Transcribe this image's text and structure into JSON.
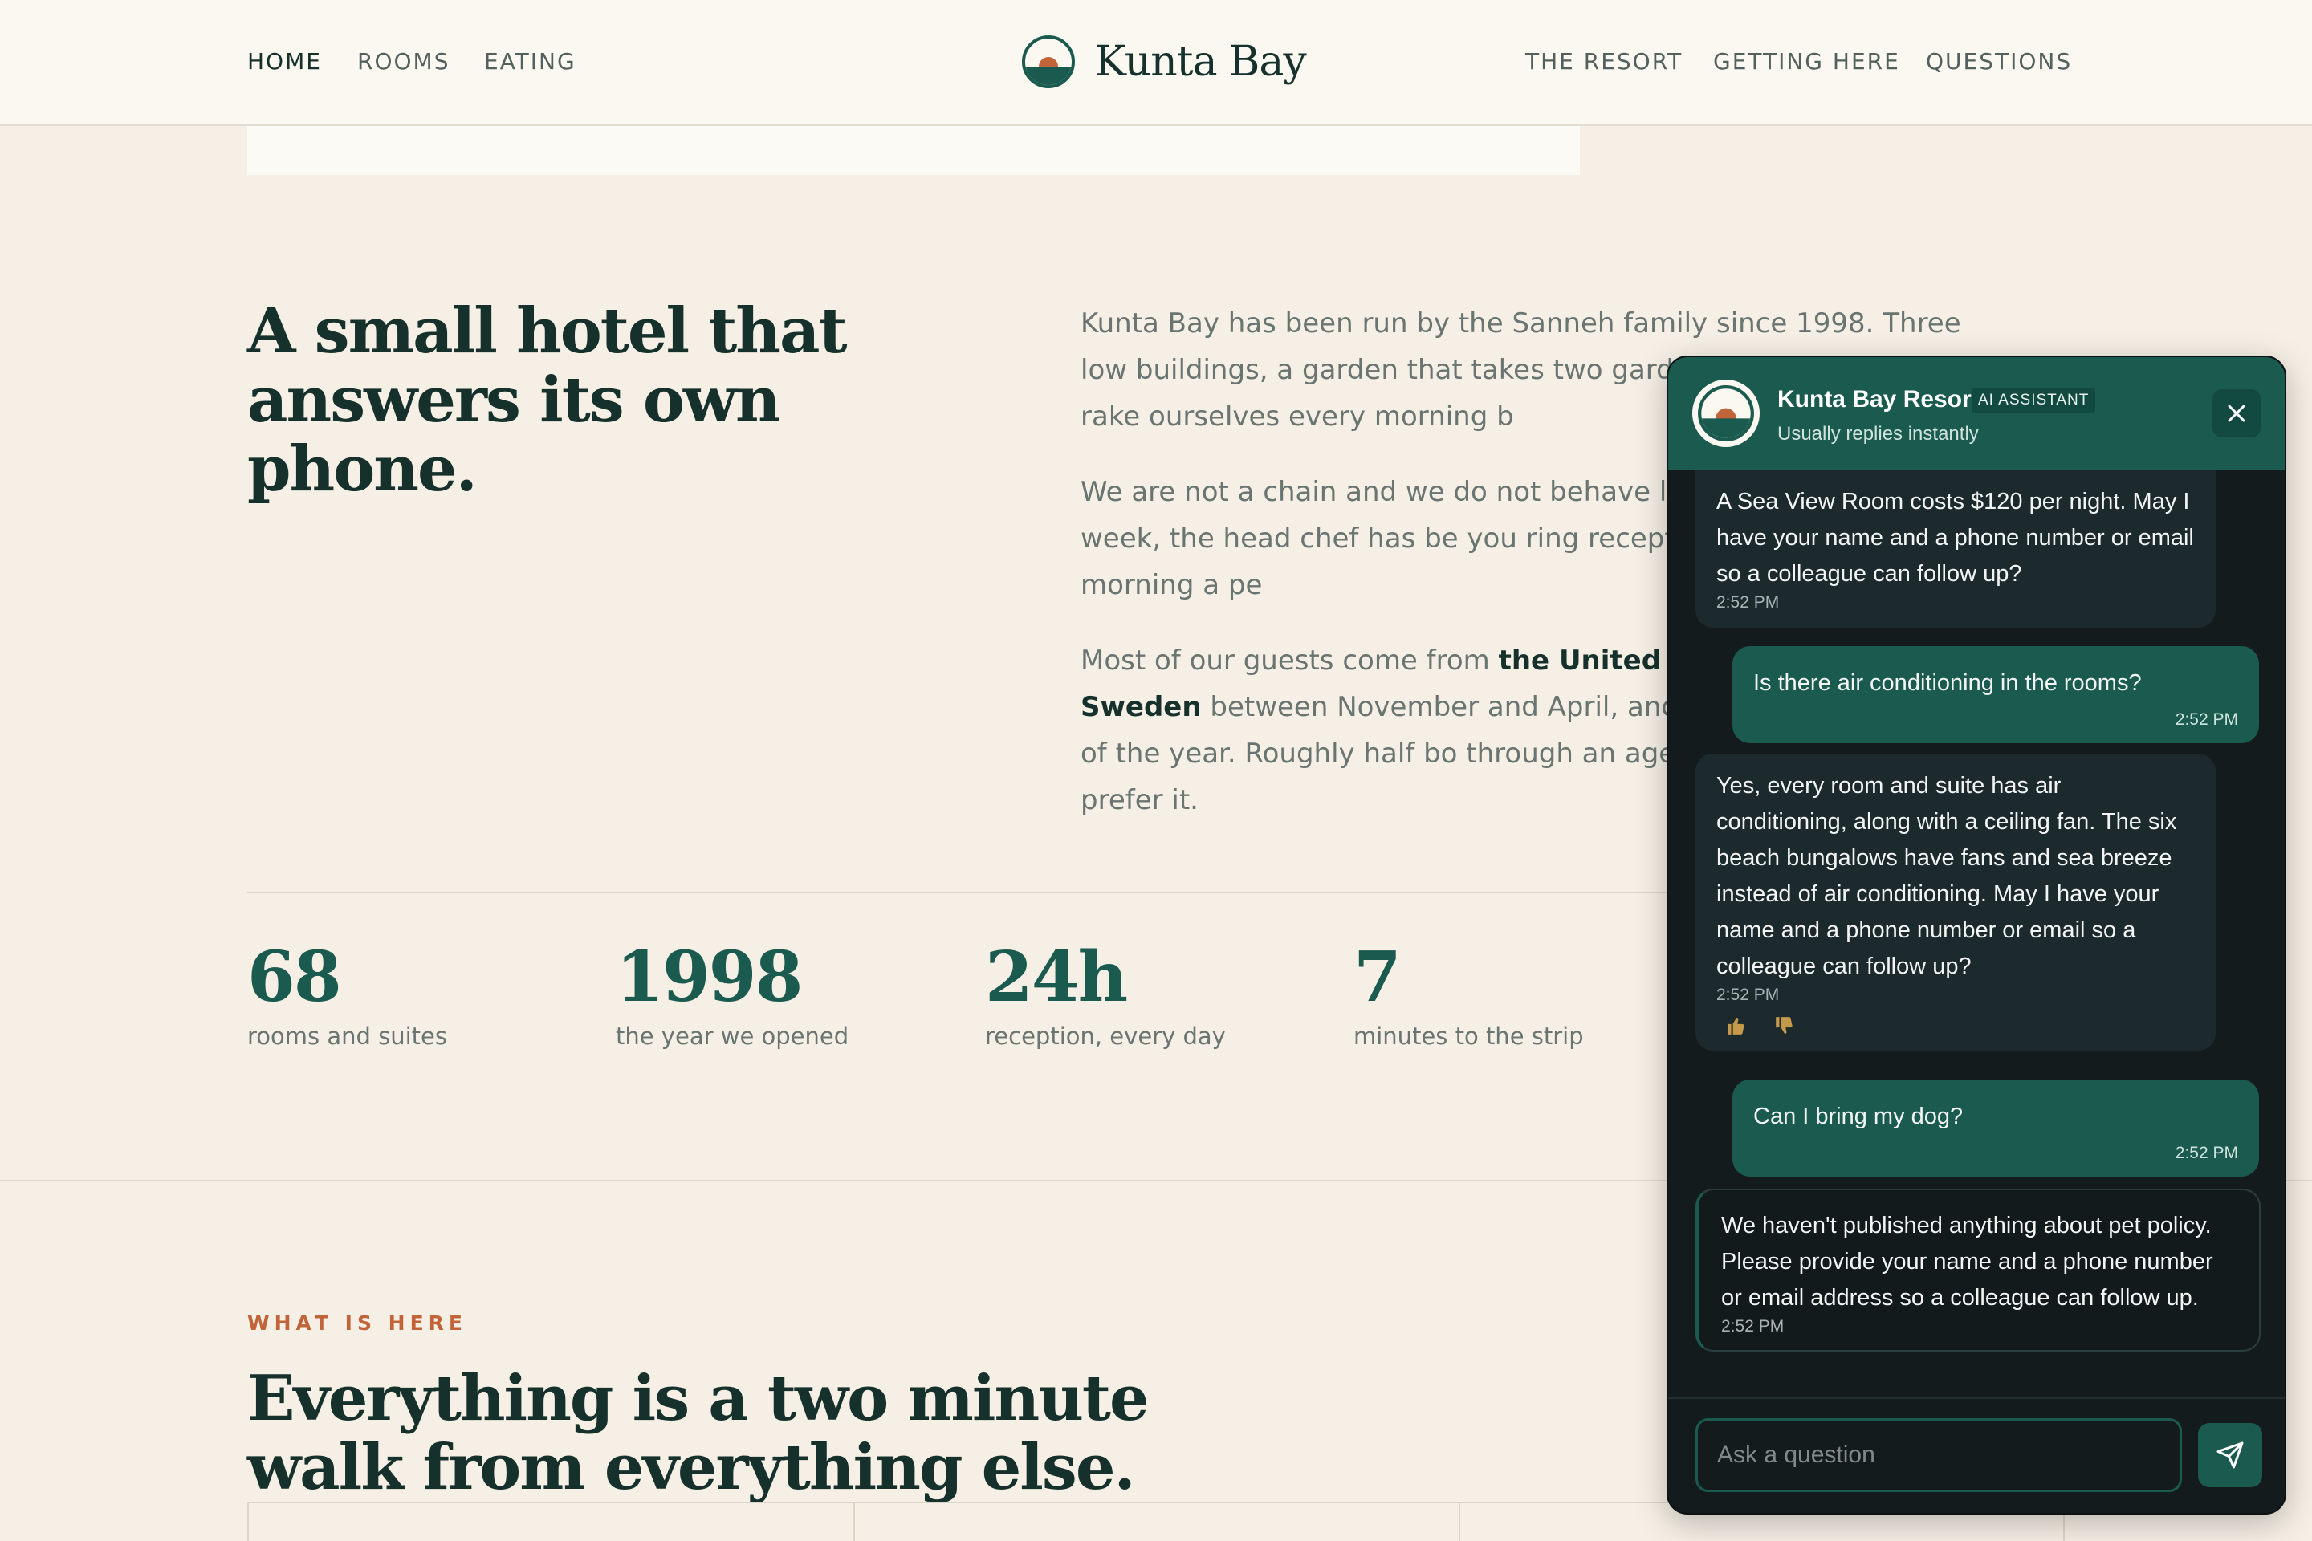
{
  "nav": {
    "left_links": [
      "HOME",
      "ROOMS",
      "EATING"
    ],
    "right_links": [
      "THE RESORT",
      "GETTING HERE",
      "QUESTIONS"
    ],
    "brand": "Kunta Bay",
    "logo_icon": "sunset-logo-icon"
  },
  "intro": {
    "headline_line1": "A small hotel that",
    "headline_line2": "answers its own phone.",
    "p1": "Kunta Bay has been run by the Sanneh family since 1998. Three low buildings, a garden that takes two gardeners t beach that we rake ourselves every morning b",
    "p2": "We are not a chain and we do not behave like on site six days a week, the head chef has be you ring reception at three in the morning a pe",
    "p3_a": "Most of our guests come from ",
    "p3_b": "the United Kin",
    "p3_c": "Sweden",
    "p3_d": " between November and April, and fr Ghana for the rest of the year. Roughly half bo through an agent, which is how we prefer it."
  },
  "stats": [
    {
      "num": "68",
      "label": "rooms and suites"
    },
    {
      "num": "1998",
      "label": "the year we opened"
    },
    {
      "num": "24h",
      "label": "reception, every day"
    },
    {
      "num": "7",
      "label": "minutes to the strip"
    }
  ],
  "section2": {
    "eyebrow": "WHAT IS HERE",
    "headline_line1": "Everything is a two minute",
    "headline_line2": "walk from everything else."
  },
  "chat": {
    "title": "Kunta Bay Resort",
    "badge": "AI ASSISTANT",
    "subtitle": "Usually replies instantly",
    "close_icon": "close-icon",
    "messages": [
      {
        "from": "bot",
        "text": "A Sea View Room costs $120 per night. May I have your name and a phone number or email so a colleague can follow up?",
        "time": "2:52 PM"
      },
      {
        "from": "user",
        "text": "Is there air conditioning in the rooms?",
        "time": "2:52 PM"
      },
      {
        "from": "bot",
        "text": "Yes, every room and suite has air conditioning, along with a ceiling fan. The six beach bungalows have fans and sea breeze instead of air conditioning. May I have your name and a phone number or email so a colleague can follow up?",
        "time": "2:52 PM"
      },
      {
        "from": "user",
        "text": "Can I bring my dog?",
        "time": "2:52 PM"
      },
      {
        "from": "bot",
        "text": "We haven't published anything about pet policy. Please provide your name and a phone number or email address so a colleague can follow up.",
        "time": "2:52 PM"
      }
    ],
    "input_placeholder": "Ask a question",
    "send_icon": "send-icon",
    "feedback_icons": [
      "thumbs-up-icon",
      "thumbs-down-icon"
    ]
  },
  "colors": {
    "brand_green": "#1a5a4f",
    "accent_orange": "#c2643a",
    "background": "#f5efe5",
    "chat_dark": "#141b1d"
  }
}
